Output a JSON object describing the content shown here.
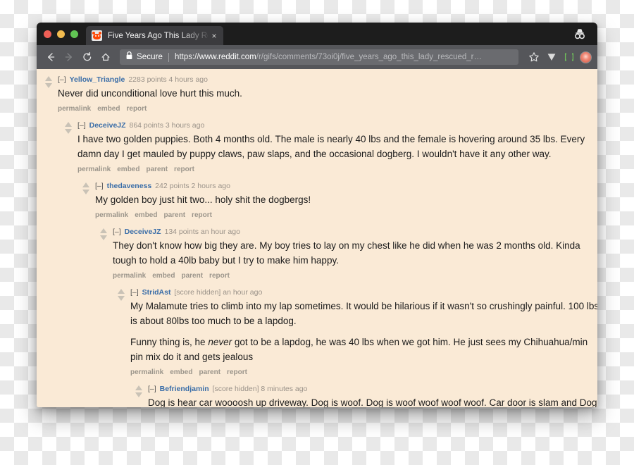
{
  "window": {
    "traffic_lights": [
      "close",
      "minimize",
      "zoom"
    ],
    "colors": {
      "close": "#ef5f56",
      "minimize": "#f3bc4f",
      "zoom": "#61c554",
      "tabstrip_bg": "#1d1d1d",
      "toolbar_bg": "#55565a",
      "page_bg": "#faead6",
      "link_blue": "#3b6ea8"
    }
  },
  "tab": {
    "title": "Five Years Ago This Lady Resc",
    "favicon": "reddit-favicon",
    "close_label": "×"
  },
  "toolbar": {
    "back_icon": "back-arrow-icon",
    "forward_icon": "forward-arrow-icon",
    "reload_icon": "reload-icon",
    "home_icon": "home-icon",
    "lock_icon": "lock-icon",
    "secure_label": "Secure",
    "url_scheme": "https://",
    "url_host": "www.reddit.com",
    "url_path": "/r/gifs/comments/73oi0j/five_years_ago_this_lady_rescued_r…",
    "bookmark_icon": "star-icon",
    "extension_v_icon": "v-extension-icon",
    "extension_bracket_icon": "bracket-extension-icon",
    "profile_icon": "profile-avatar-icon",
    "incognito_icon": "incognito-icon"
  },
  "comments": [
    {
      "level": 0,
      "collapse": "[–]",
      "author": "Yellow_Triangle",
      "score": "2283 points 4 hours ago",
      "paragraphs": [
        "Never did unconditional love hurt this much."
      ],
      "actions": [
        "permalink",
        "embed",
        "report"
      ]
    },
    {
      "level": 1,
      "collapse": "[–]",
      "author": "DeceiveJZ",
      "score": "864 points 3 hours ago",
      "paragraphs": [
        "I have two golden puppies. Both 4 months old. The male is nearly 40 lbs and the female is hovering around 35 lbs. Every damn day I get mauled by puppy claws, paw slaps, and the occasional dogberg. I wouldn't have it any other way."
      ],
      "actions": [
        "permalink",
        "embed",
        "parent",
        "report"
      ]
    },
    {
      "level": 2,
      "collapse": "[–]",
      "author": "thedaveness",
      "score": "242 points 2 hours ago",
      "paragraphs": [
        "My golden boy just hit two... holy shit the dogbergs!"
      ],
      "actions": [
        "permalink",
        "embed",
        "parent",
        "report"
      ]
    },
    {
      "level": 3,
      "collapse": "[–]",
      "author": "DeceiveJZ",
      "score": "134 points an hour ago",
      "paragraphs": [
        "They don't know how big they are. My boy tries to lay on my chest like he did when he was 2 months old. Kinda tough to hold a 40lb baby but I try to make him happy."
      ],
      "actions": [
        "permalink",
        "embed",
        "parent",
        "report"
      ]
    },
    {
      "level": 4,
      "collapse": "[–]",
      "author": "StridAst",
      "score": "[score hidden] an hour ago",
      "paragraphs": [
        "My Malamute tries to climb into my lap sometimes. It would be hilarious if it wasn't so crushingly painful. 100 lbs is about 80lbs too much to be a lapdog.",
        "Funny thing is, he never got to be a lapdog, he was 40 lbs when we got him. He just sees my Chihuahua/min pin mix do it and gets jealous"
      ],
      "emphasis_word": "never",
      "actions": [
        "permalink",
        "embed",
        "parent",
        "report"
      ]
    },
    {
      "level": 5,
      "collapse": "[–]",
      "author": "Befriendjamin",
      "score": "[score hidden] 8 minutes ago",
      "paragraphs": [
        "Dog is hear car woooosh up driveway. Dog is woof. Dog is woof woof woof woof. Car door is slam and Dog is bring Octopus stuffy friend to door. Dog is wag tail. Man is open front door. Dog is run"
      ],
      "actions": []
    }
  ]
}
